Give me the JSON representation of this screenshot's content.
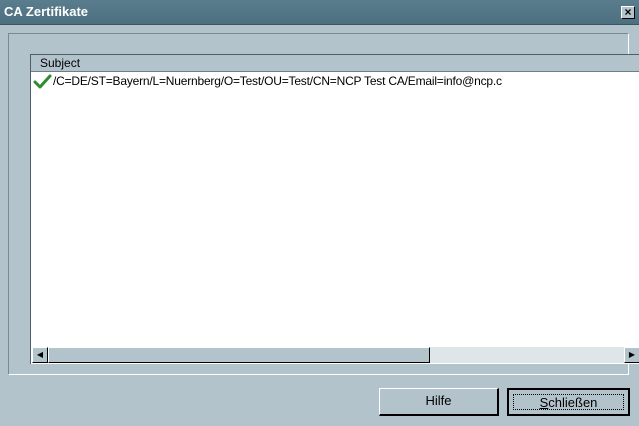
{
  "window": {
    "title": "CA Zertifikate",
    "close_glyph": "×"
  },
  "list": {
    "column_header": "Subject",
    "rows": [
      {
        "icon": "checkmark-icon",
        "icon_color": "#2e8b2e",
        "subject": "/C=DE/ST=Bayern/L=Nuernberg/O=Test/OU=Test/CN=NCP Test CA/Email=info@ncp.c"
      }
    ]
  },
  "scrollbar": {
    "left_arrow": "◀",
    "right_arrow": "▶"
  },
  "buttons": {
    "help": "Hilfe",
    "close_first": "S",
    "close_rest": "chließen"
  },
  "colors": {
    "titlebar": "#4d7080",
    "face": "#b3c3cc",
    "list_bg": "#ffffff"
  }
}
